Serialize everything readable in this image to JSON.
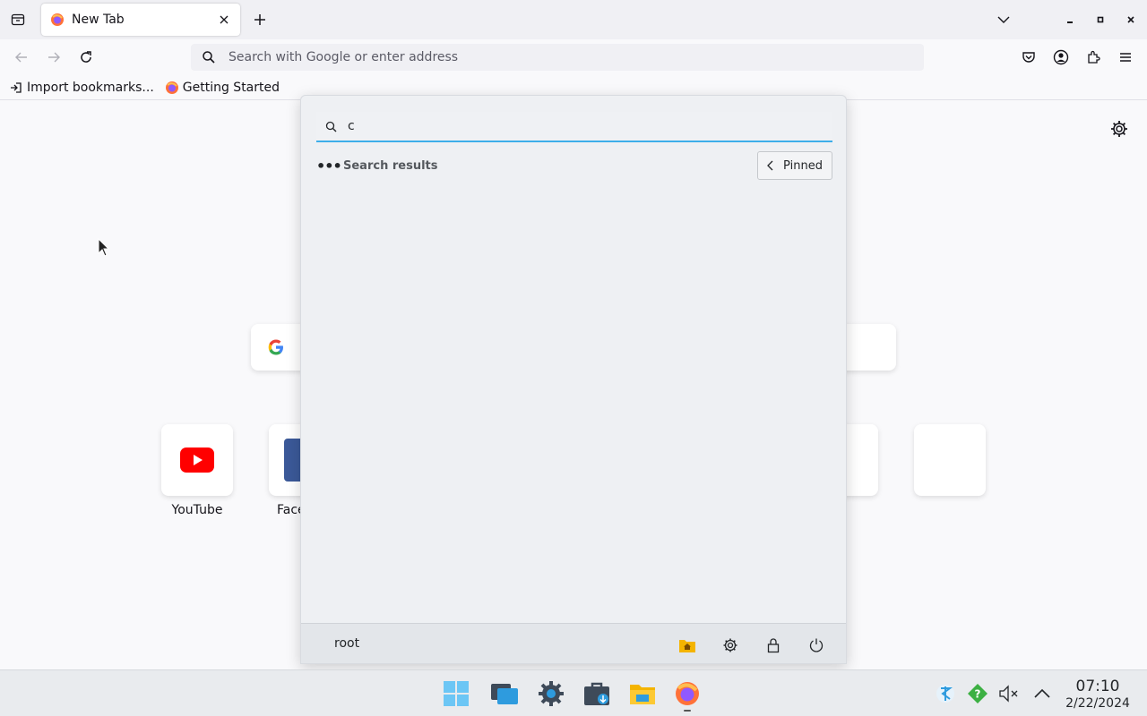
{
  "browser": {
    "tab": {
      "title": "New Tab"
    },
    "urlbar": {
      "placeholder": "Search with Google or enter address"
    },
    "bookmarks": [
      {
        "label": "Import bookmarks...",
        "icon": "import-icon"
      },
      {
        "label": "Getting Started",
        "icon": "firefox-icon"
      }
    ]
  },
  "newtab": {
    "tiles": [
      {
        "label": "YouTube",
        "icon": "youtube-icon"
      },
      {
        "label": "Face",
        "icon": "facebook-icon"
      },
      {
        "label": "",
        "icon": "blank-tile"
      },
      {
        "label": "",
        "icon": "blank-tile"
      }
    ]
  },
  "startmenu": {
    "search_value": "c",
    "section_title": "Search results",
    "pinned_label": "Pinned",
    "user": "root",
    "footer_actions": [
      "home-folder-icon",
      "settings-icon",
      "lock-icon",
      "power-icon"
    ]
  },
  "taskbar": {
    "apps": [
      "start-menu-icon",
      "window-overview-icon",
      "system-settings-icon",
      "discover-store-icon",
      "file-manager-icon",
      "firefox-icon"
    ],
    "tray": [
      "kde-connect-icon",
      "updates-icon",
      "volume-muted-icon",
      "tray-expand-icon"
    ],
    "time": "07:10",
    "date": "2/22/2024"
  },
  "colors": {
    "accent": "#3daee9",
    "youtube_red": "#ff0000"
  }
}
